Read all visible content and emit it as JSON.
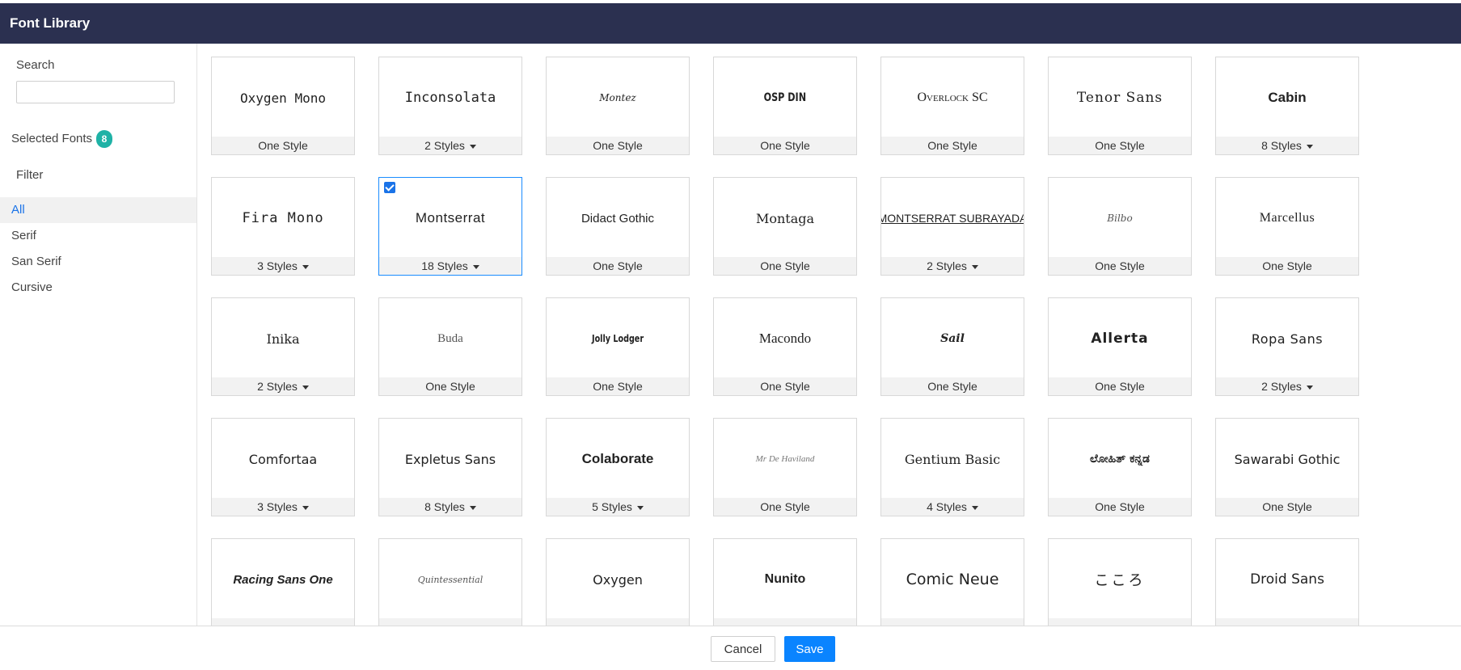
{
  "header": {
    "title": "Font Library"
  },
  "sidebar": {
    "search_label": "Search",
    "search_value": "",
    "search_placeholder": "",
    "selected_label": "Selected Fonts",
    "selected_count": "8",
    "filter_label": "Filter",
    "filters": [
      {
        "label": "All",
        "active": true
      },
      {
        "label": "Serif",
        "active": false
      },
      {
        "label": "San Serif",
        "active": false
      },
      {
        "label": "Cursive",
        "active": false
      }
    ]
  },
  "fonts": [
    {
      "name": "Oxygen Mono",
      "styles": "One Style",
      "has_dropdown": false,
      "selected": false
    },
    {
      "name": "Inconsolata",
      "styles": "2 Styles",
      "has_dropdown": true,
      "selected": false
    },
    {
      "name": "Montez",
      "styles": "One Style",
      "has_dropdown": false,
      "selected": false
    },
    {
      "name": "OSP DIN",
      "styles": "One Style",
      "has_dropdown": false,
      "selected": false
    },
    {
      "name": "Overlock SC",
      "styles": "One Style",
      "has_dropdown": false,
      "selected": false
    },
    {
      "name": "Tenor Sans",
      "styles": "One Style",
      "has_dropdown": false,
      "selected": false
    },
    {
      "name": "Cabin",
      "styles": "8 Styles",
      "has_dropdown": true,
      "selected": false
    },
    {
      "name": "Fira Mono",
      "styles": "3 Styles",
      "has_dropdown": true,
      "selected": false
    },
    {
      "name": "Montserrat",
      "styles": "18 Styles",
      "has_dropdown": true,
      "selected": true
    },
    {
      "name": "Didact Gothic",
      "styles": "One Style",
      "has_dropdown": false,
      "selected": false
    },
    {
      "name": "Montaga",
      "styles": "One Style",
      "has_dropdown": false,
      "selected": false
    },
    {
      "name": "MONTSERRAT SUBRAYADA",
      "styles": "2 Styles",
      "has_dropdown": true,
      "selected": false
    },
    {
      "name": "Bilbo",
      "styles": "One Style",
      "has_dropdown": false,
      "selected": false
    },
    {
      "name": "Marcellus",
      "styles": "One Style",
      "has_dropdown": false,
      "selected": false
    },
    {
      "name": "Inika",
      "styles": "2 Styles",
      "has_dropdown": true,
      "selected": false
    },
    {
      "name": "Buda",
      "styles": "One Style",
      "has_dropdown": false,
      "selected": false
    },
    {
      "name": "Jolly Lodger",
      "styles": "One Style",
      "has_dropdown": false,
      "selected": false
    },
    {
      "name": "Macondo",
      "styles": "One Style",
      "has_dropdown": false,
      "selected": false
    },
    {
      "name": "Sail",
      "styles": "One Style",
      "has_dropdown": false,
      "selected": false
    },
    {
      "name": "Allerta",
      "styles": "One Style",
      "has_dropdown": false,
      "selected": false
    },
    {
      "name": "Ropa Sans",
      "styles": "2 Styles",
      "has_dropdown": true,
      "selected": false
    },
    {
      "name": "Comfortaa",
      "styles": "3 Styles",
      "has_dropdown": true,
      "selected": false
    },
    {
      "name": "Expletus Sans",
      "styles": "8 Styles",
      "has_dropdown": true,
      "selected": false
    },
    {
      "name": "Colaborate",
      "styles": "5 Styles",
      "has_dropdown": true,
      "selected": false
    },
    {
      "name": "Mr De Haviland",
      "styles": "One Style",
      "has_dropdown": false,
      "selected": false
    },
    {
      "name": "Gentium Basic",
      "styles": "4 Styles",
      "has_dropdown": true,
      "selected": false
    },
    {
      "name": "ಲೋಹಿತ್ ಕನ್ನಡ",
      "styles": "One Style",
      "has_dropdown": false,
      "selected": false
    },
    {
      "name": "Sawarabi Gothic",
      "styles": "One Style",
      "has_dropdown": false,
      "selected": false
    },
    {
      "name": "Racing Sans One",
      "styles": "",
      "has_dropdown": false,
      "selected": false
    },
    {
      "name": "Quintessential",
      "styles": "",
      "has_dropdown": false,
      "selected": false
    },
    {
      "name": "Oxygen",
      "styles": "",
      "has_dropdown": false,
      "selected": false
    },
    {
      "name": "Nunito",
      "styles": "",
      "has_dropdown": false,
      "selected": false
    },
    {
      "name": "Comic Neue",
      "styles": "",
      "has_dropdown": false,
      "selected": false
    },
    {
      "name": "こころ",
      "styles": "",
      "has_dropdown": false,
      "selected": false
    },
    {
      "name": "Droid Sans",
      "styles": "",
      "has_dropdown": false,
      "selected": false
    }
  ],
  "footer": {
    "cancel_label": "Cancel",
    "save_label": "Save"
  },
  "colors": {
    "header_bg": "#2b3050",
    "accent": "#1a73e8",
    "badge": "#1fb2a6",
    "save_bg": "#0a84ff"
  }
}
